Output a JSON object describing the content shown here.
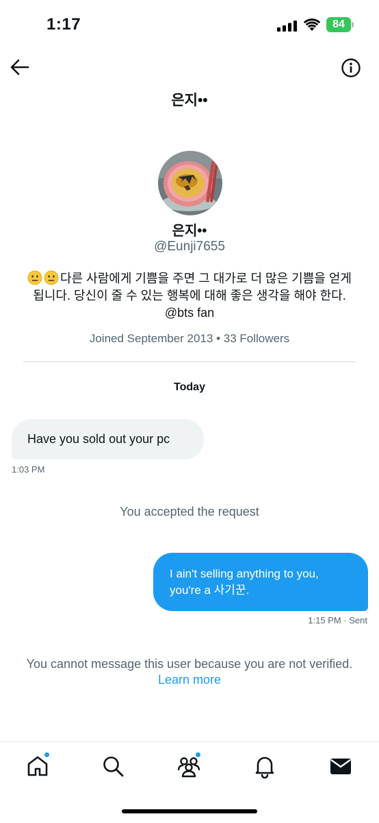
{
  "status_bar": {
    "time": "1:17",
    "battery": "84"
  },
  "header": {
    "title": "은지••"
  },
  "profile": {
    "name": "은지••",
    "handle": "@Eunji7655",
    "bio": "다른 사람에게 기쁨을 주면 그 대가로 더 많은 기쁨을 얻게 됩니다. 당신이 줄 수 있는 행복에 대해 좋은 생각을 해야 한다. @bts fan",
    "bio_emoji": "neutral-face-emoji",
    "meta": "Joined September 2013 • 33 Followers"
  },
  "conversation": {
    "day_label": "Today",
    "incoming": {
      "text": "Have you sold out your pc",
      "time": "1:03 PM"
    },
    "system_message": "You accepted the request",
    "outgoing": {
      "line1": "I ain't selling anything to you,",
      "line2": "you're a 사기꾼.",
      "time": "1:15 PM · Sent"
    }
  },
  "notice": {
    "text": "You cannot message this user because you are not verified.",
    "link": "Learn more"
  },
  "tabbar": {
    "items": [
      "home-icon",
      "search-icon",
      "communities-icon",
      "notifications-icon",
      "messages-icon"
    ]
  },
  "colors": {
    "accent": "#1d9bf0",
    "battery": "#34c759",
    "secondary_text": "#536471",
    "incoming_bubble": "#eff3f4"
  }
}
